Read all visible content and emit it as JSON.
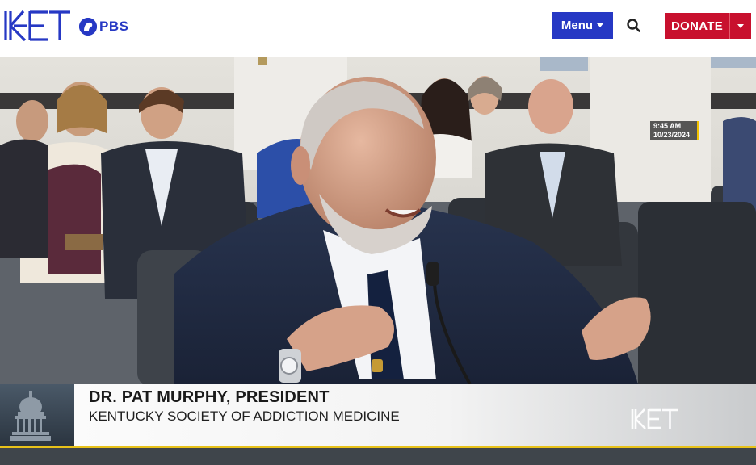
{
  "header": {
    "logo_name": "KET",
    "partner_logo": "PBS",
    "menu_label": "Menu",
    "search_icon": "search-icon",
    "donate_label": "DONATE"
  },
  "video": {
    "timestamp_time": "9:45 AM",
    "timestamp_date": "10/23/2024",
    "lower_third": {
      "name": "DR. PAT MURPHY, PRESIDENT",
      "title": "KENTUCKY SOCIETY OF ADDICTION MEDICINE",
      "logo": "KET"
    }
  },
  "colors": {
    "brand_blue": "#2638c4",
    "donate_red": "#c8102e",
    "accent_gold": "#e8c21a"
  }
}
